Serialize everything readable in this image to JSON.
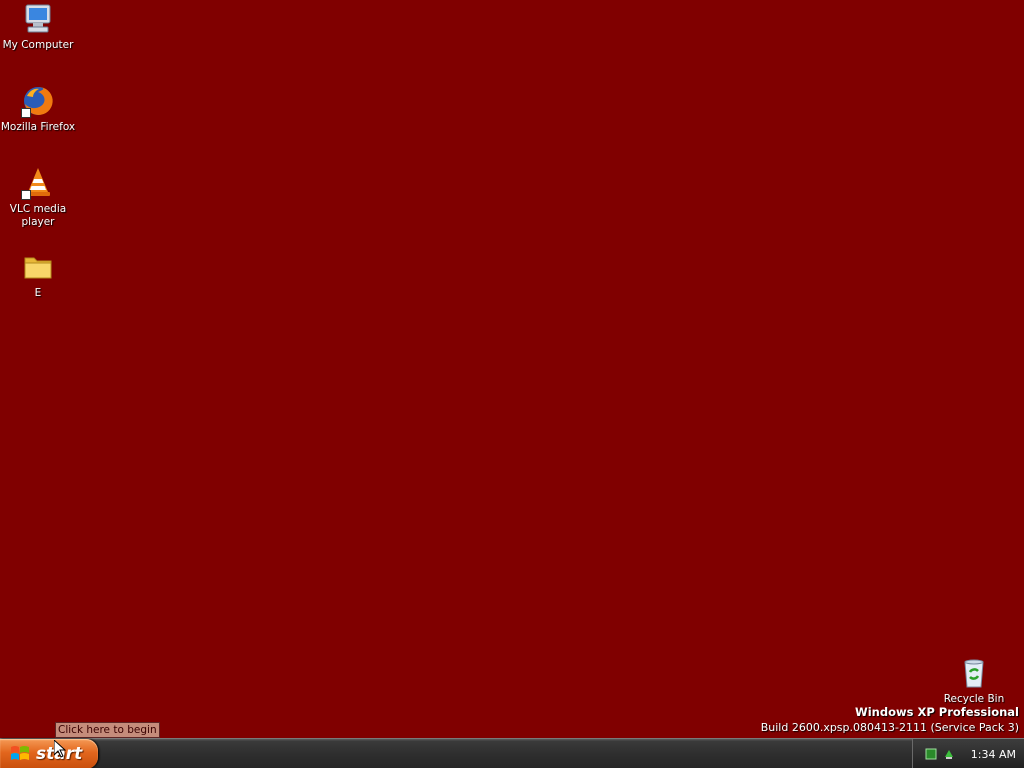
{
  "desktop": {
    "background_color": "#800000",
    "icons": [
      {
        "label": "My Computer",
        "icon": "computer-icon"
      },
      {
        "label": "Mozilla Firefox",
        "icon": "firefox-icon"
      },
      {
        "label": "VLC media player",
        "icon": "vlc-icon"
      },
      {
        "label": "E",
        "icon": "folder-icon"
      }
    ],
    "recycle_bin": {
      "label": "Recycle Bin",
      "icon": "recycle-bin-icon"
    }
  },
  "branding": {
    "product": "Windows XP Professional",
    "build": "Build 2600.xpsp.080413-2111 (Service Pack 3)"
  },
  "tooltip": {
    "text": "Click here to begin"
  },
  "taskbar": {
    "start_label": "start",
    "tray_icons": [
      "network-icon",
      "safely-remove-icon"
    ],
    "clock": "1:34 AM"
  }
}
